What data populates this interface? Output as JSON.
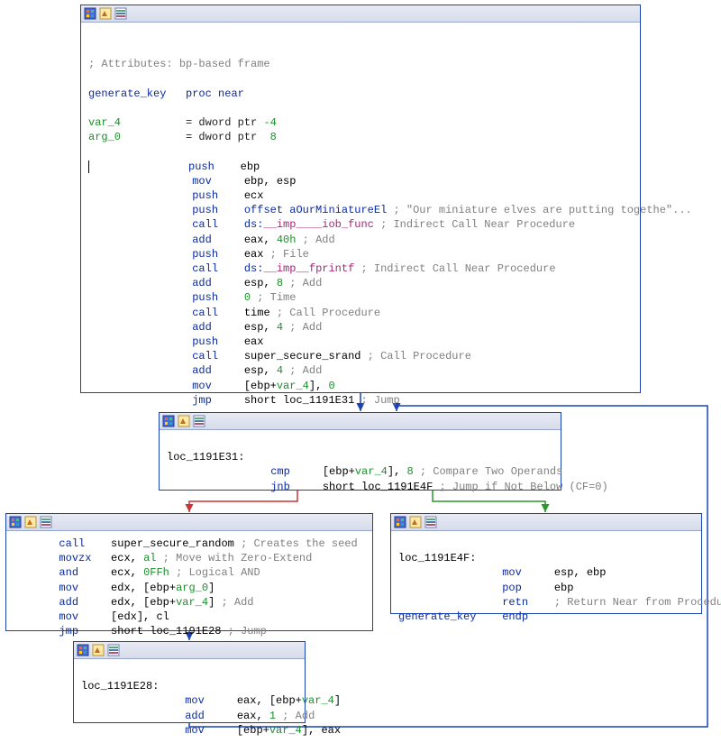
{
  "icons": {
    "palette": "palette-icon",
    "paint": "paint-icon",
    "group": "group-icon"
  },
  "node1": {
    "attr_comment": "; Attributes: bp-based frame",
    "proc_name": "generate_key",
    "proc_kw": "proc near",
    "var4": "var_4",
    "var4_def": "= dword ptr ",
    "var4_off": "-4",
    "arg0": "arg_0",
    "arg0_def": "= dword ptr  ",
    "arg0_off": "8",
    "i": {
      "push": "push",
      "mov": "mov",
      "call": "call",
      "add": "add",
      "jmp": "jmp",
      "ebp": "ebp",
      "esp": "esp",
      "ecx": "ecx",
      "eax": "eax",
      "mov_ebp_esp": "ebp, esp",
      "offset_str": "offset aOurMiniatureEl ",
      "offset_cmt": "; \"Our miniature elves are putting togethe\"...",
      "ds": "ds:",
      "imp_iob": "__imp____iob_func",
      "imp_iob_cmt": " ; Indirect Call Near Procedure",
      "add40": "eax, ",
      "h40": "40h",
      "add40_cmt": " ; Add",
      "push_eax_file": "eax ",
      "push_eax_file_cmt": "; File",
      "imp_fprintf": "__imp__fprintf",
      "imp_fprintf_cmt": " ; Indirect Call Near Procedure",
      "add_esp8": "esp, ",
      "n8": "8",
      "add_cmt": " ; Add",
      "push0": "0 ",
      "push0_cmt": "; Time",
      "time": "time",
      "time_cmt": " ; Call Procedure",
      "add_esp4": "esp, ",
      "n4": "4",
      "srand": "super_secure_srand",
      "srand_cmt": " ; Call Procedure",
      "mov_var4_0": "[ebp+",
      "mov_var4_0b": "], ",
      "zero": "0",
      "jmp_tgt": "short loc_1191E31",
      "jmp_cmt": " ; Jump"
    }
  },
  "node2": {
    "label": "loc_1191E31:",
    "cmp": "cmp",
    "cmp_op": "[ebp+",
    "cmp_op2": "], ",
    "cmp_n": "8",
    "cmp_cmt": " ; Compare Two Operands",
    "jnb": "jnb",
    "jnb_tgt": "short loc_1191E4F",
    "jnb_cmt": " ; Jump if Not Below (CF=0)"
  },
  "node3": {
    "call": "call",
    "rand": "super_secure_random",
    "rand_cmt": " ; Creates the seed",
    "movzx": "movzx",
    "movzx_op": "ecx, ",
    "movzx_reg": "al",
    "movzx_cmt": " ; Move with Zero-Extend",
    "and": "and",
    "and_op": "ecx, ",
    "and_n": "0FFh",
    "and_cmt": " ; Logical AND",
    "mov": "mov",
    "mov_edx": "edx, [ebp+",
    "mov_edx_b": "]",
    "add": "add",
    "add_edx": "edx, [ebp+",
    "add_edx_b": "]",
    "add_cmt": " ; Add",
    "mov_mem": "[edx], cl",
    "jmp": "jmp",
    "jmp_tgt": "short loc_1191E28",
    "jmp_cmt": " ; Jump"
  },
  "node4": {
    "label": "loc_1191E4F:",
    "mov": "mov",
    "mov_op": "esp, ebp",
    "pop": "pop",
    "pop_op": "ebp",
    "retn": "retn",
    "retn_cmt": "; Return Near from Procedure",
    "endp_name": "generate_key",
    "endp": "endp"
  },
  "node5": {
    "label": "loc_1191E28:",
    "mov": "mov",
    "mov1a": "eax, [ebp+",
    "mov1b": "]",
    "add": "add",
    "add_op": "eax, ",
    "one": "1",
    "add_cmt": " ; Add",
    "mov2a": "[ebp+",
    "mov2b": "], eax"
  }
}
